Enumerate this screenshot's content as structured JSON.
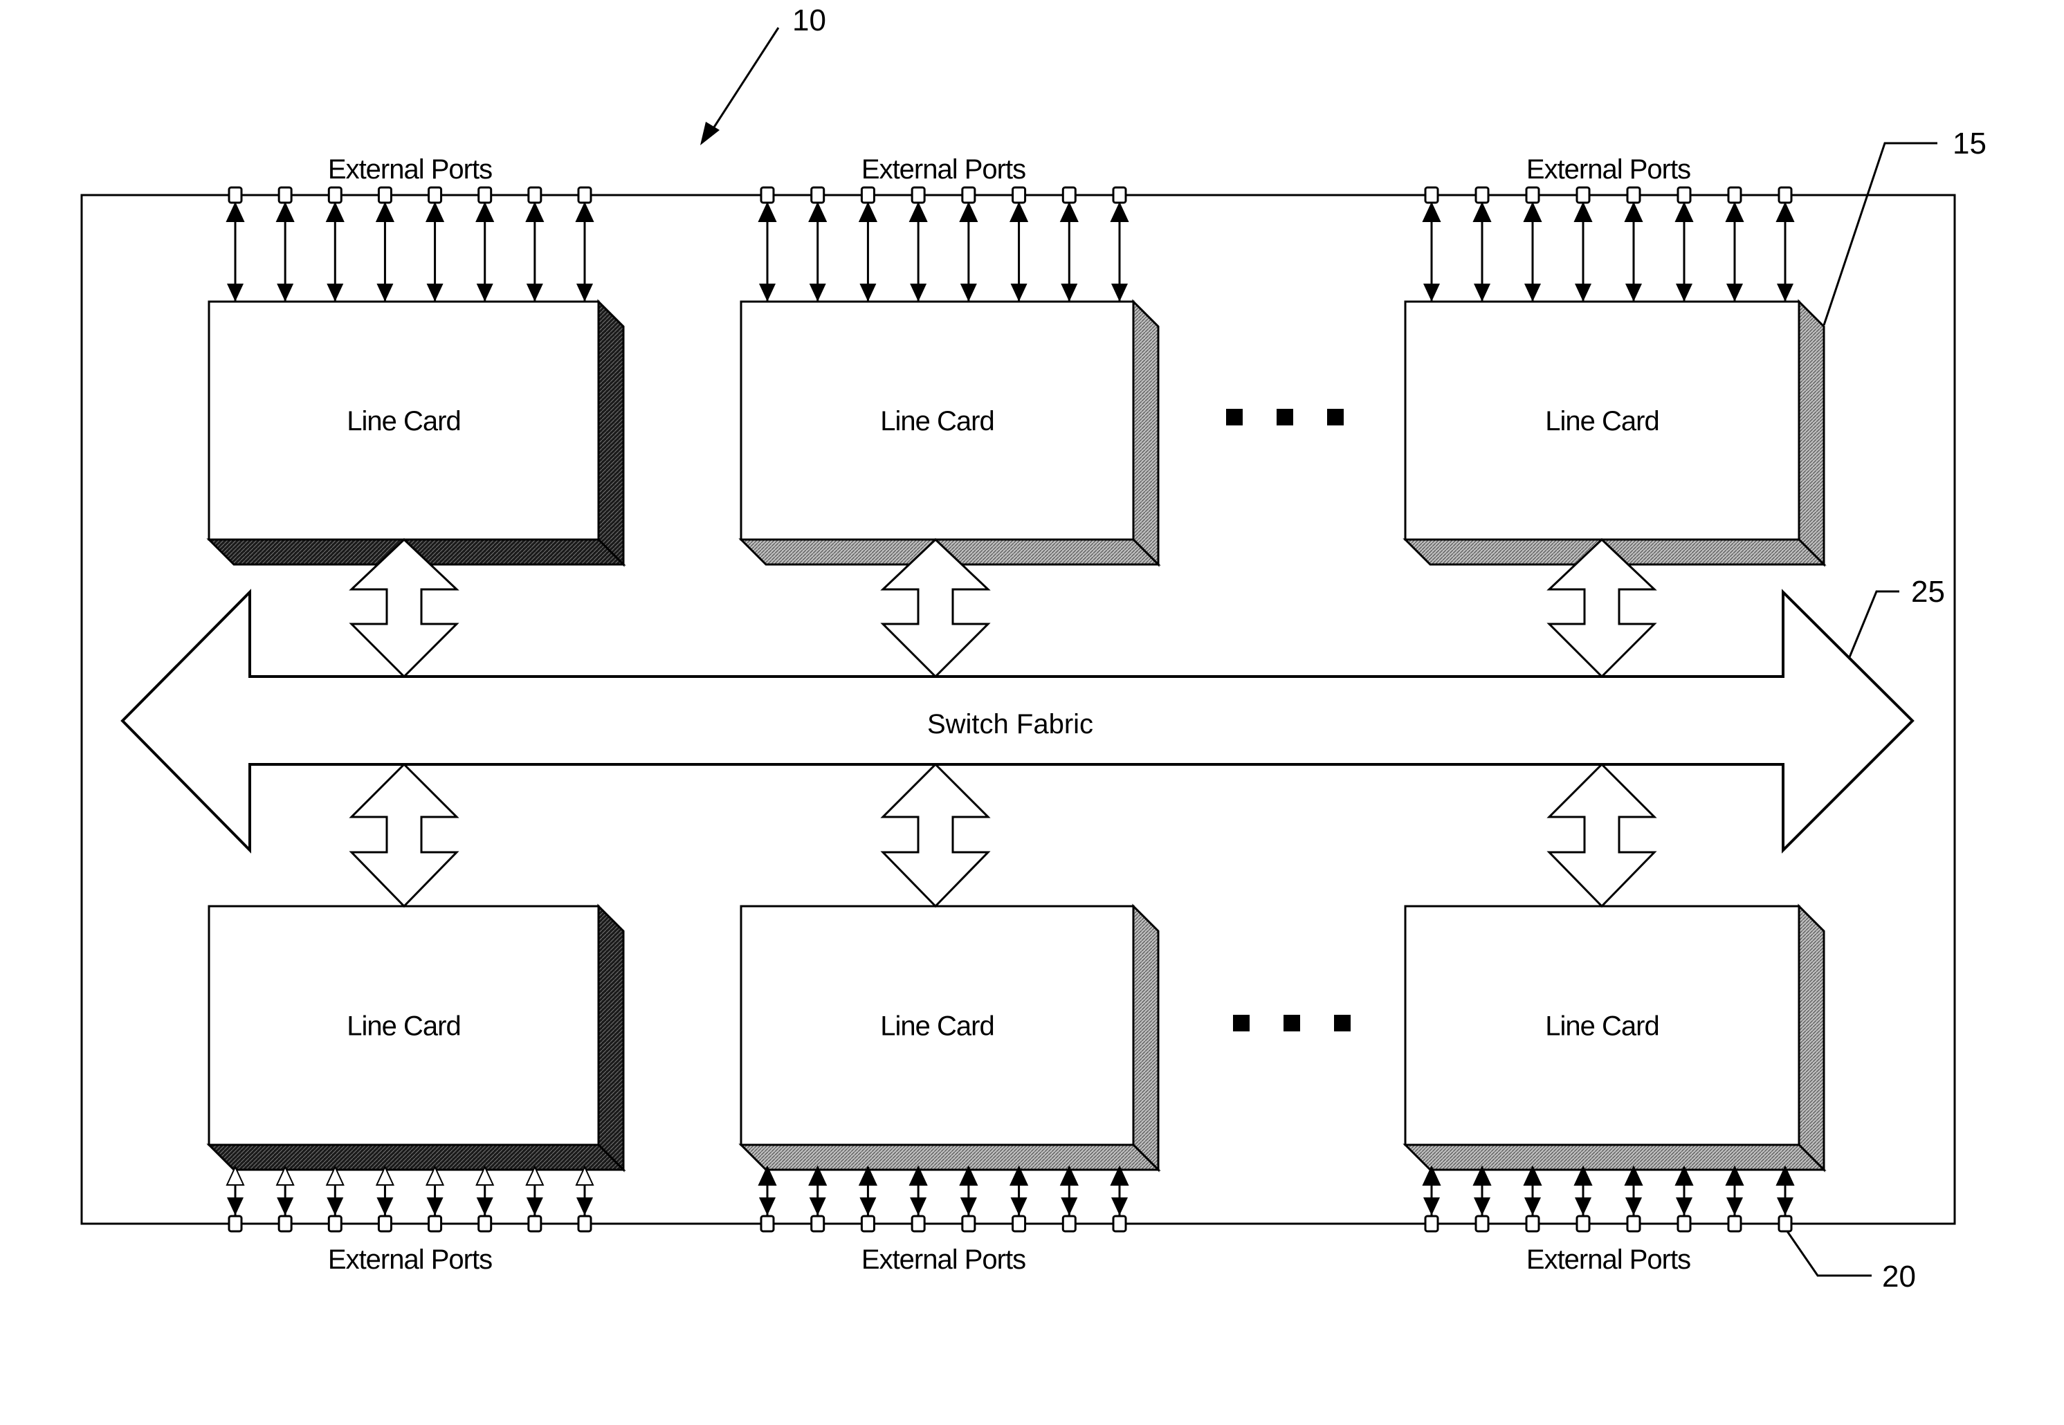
{
  "figure": {
    "reference_numerals": {
      "system": "10",
      "line_card": "15",
      "port": "20",
      "switch_fabric": "25"
    },
    "switch_fabric": {
      "label": "Switch Fabric",
      "direction": "bidirectional-horizontal"
    },
    "continuation_marker": "■ ■ ■",
    "rows": [
      {
        "position": "top",
        "cards": [
          {
            "label": "Line Card",
            "ports_label": "External Ports",
            "port_count": 8,
            "shade": "dark"
          },
          {
            "label": "Line Card",
            "ports_label": "External Ports",
            "port_count": 8,
            "shade": "medium"
          },
          {
            "label": "Line Card",
            "ports_label": "External Ports",
            "port_count": 8,
            "shade": "medium"
          }
        ]
      },
      {
        "position": "bottom",
        "cards": [
          {
            "label": "Line Card",
            "ports_label": "External Ports",
            "port_count": 8,
            "shade": "dark"
          },
          {
            "label": "Line Card",
            "ports_label": "External Ports",
            "port_count": 8,
            "shade": "medium"
          },
          {
            "label": "Line Card",
            "ports_label": "External Ports",
            "port_count": 8,
            "shade": "medium"
          }
        ]
      }
    ],
    "colors": {
      "stroke": "#000000",
      "background": "#ffffff",
      "shade_dark": "#1a1a1a",
      "shade_medium": "#9a9a9a",
      "port_fill": "#ffffff"
    }
  }
}
